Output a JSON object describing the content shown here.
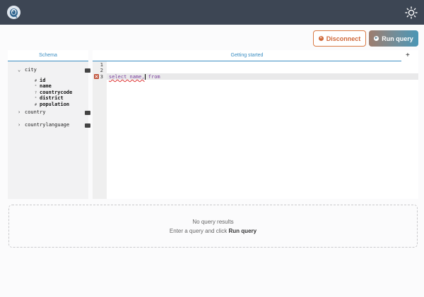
{
  "topbar": {
    "logo_icon": "postgres-elephant-icon",
    "theme_icon": "sun-icon"
  },
  "actions": {
    "disconnect_label": "Disconnect",
    "disconnect_icon": "x-circle-icon",
    "run_label": "Run query",
    "run_icon": "play-circle-icon"
  },
  "schema": {
    "tab_label": "Schema",
    "tables": [
      {
        "name": "city",
        "expanded": true,
        "icon": "table-icon",
        "columns": [
          {
            "type_icon": "#",
            "name": "id"
          },
          {
            "type_icon": "⁰",
            "name": "name"
          },
          {
            "type_icon": "?",
            "name": "countrycode"
          },
          {
            "type_icon": "⁰",
            "name": "district"
          },
          {
            "type_icon": "#",
            "name": "population"
          }
        ]
      },
      {
        "name": "country",
        "expanded": false,
        "icon": "table-icon"
      },
      {
        "name": "countrylanguage",
        "expanded": false,
        "icon": "table-icon"
      }
    ]
  },
  "editor": {
    "tab_label": "Getting started",
    "add_tab_label": "+",
    "line_numbers": [
      "1",
      "2",
      "3"
    ],
    "code_before_caret": "select name,",
    "code_after_caret": " from",
    "error_line": 3
  },
  "results": {
    "empty_title": "No query results",
    "hint_prefix": "Enter a query and click ",
    "hint_action": "Run query"
  },
  "colors": {
    "topbar": "#3d4654",
    "accent": "#3a8dc2",
    "disconnect": "#d0693a",
    "error": "#c0523a"
  }
}
